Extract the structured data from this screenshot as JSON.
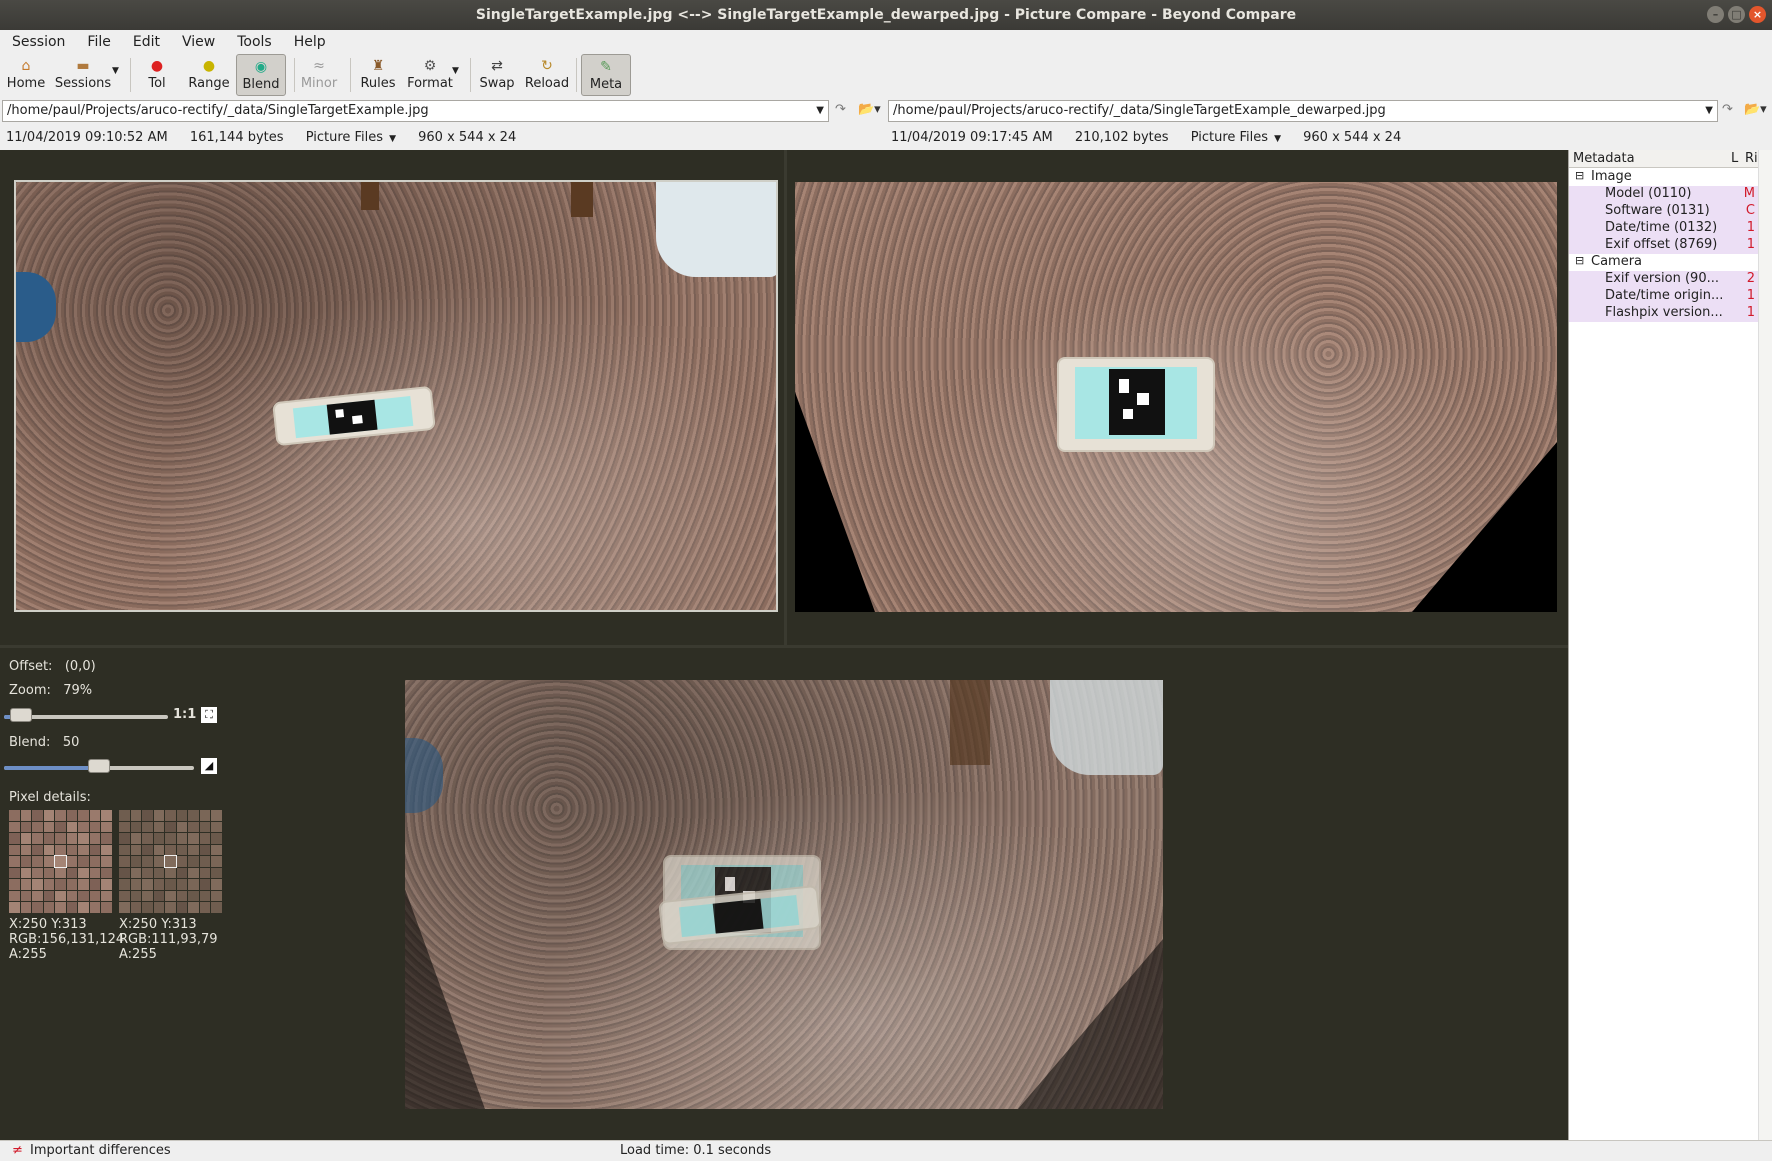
{
  "window": {
    "title": "SingleTargetExample.jpg <--> SingleTargetExample_dewarped.jpg - Picture Compare - Beyond Compare",
    "minimize": "–",
    "maximize": "□",
    "close": "×"
  },
  "menu": [
    "Session",
    "File",
    "Edit",
    "View",
    "Tools",
    "Help"
  ],
  "toolbar": {
    "home": "Home",
    "sessions": "Sessions",
    "tol": "Tol",
    "range": "Range",
    "blend": "Blend",
    "minor": "Minor",
    "rules": "Rules",
    "format": "Format",
    "swap": "Swap",
    "reload": "Reload",
    "meta": "Meta"
  },
  "left": {
    "path": "/home/paul/Projects/aruco-rectify/_data/SingleTargetExample.jpg",
    "date": "11/04/2019 09:10:52 AM",
    "size": "161,144 bytes",
    "format": "Picture Files",
    "dims": "960 x 544 x 24"
  },
  "right": {
    "path": "/home/paul/Projects/aruco-rectify/_data/SingleTargetExample_dewarped.jpg",
    "date": "11/04/2019 09:17:45 AM",
    "size": "210,102 bytes",
    "format": "Picture Files",
    "dims": "960 x 544 x 24"
  },
  "controls": {
    "offset_label": "Offset:",
    "offset_value": "(0,0)",
    "zoom_label": "Zoom:",
    "zoom_value": "79%",
    "zoom_level": 0.05,
    "one_to_one": "1:1",
    "blend_label": "Blend:",
    "blend_value": "50",
    "blend_level": 0.5,
    "pixel_details_label": "Pixel details:",
    "left_pixel": {
      "xy": "X:250 Y:313",
      "rgb": "RGB:156,131,124",
      "a": "A:255"
    },
    "right_pixel": {
      "xy": "X:250 Y:313",
      "rgb": "RGB:111,93,79",
      "a": "A:255"
    }
  },
  "metadata": {
    "headers": {
      "name": "Metadata",
      "left": "L",
      "right": "Ri"
    },
    "rows": [
      {
        "label": "Image",
        "value": "",
        "type": "group",
        "toggle": "⊟"
      },
      {
        "label": "Model (0110)",
        "value": "M",
        "type": "diff"
      },
      {
        "label": "Software (0131)",
        "value": "C",
        "type": "diff"
      },
      {
        "label": "Date/time (0132)",
        "value": "1",
        "type": "diff"
      },
      {
        "label": "Exif offset (8769)",
        "value": "1",
        "type": "diff"
      },
      {
        "label": "Camera",
        "value": "",
        "type": "group",
        "toggle": "⊟"
      },
      {
        "label": "Exif version (90...",
        "value": "2",
        "type": "diff"
      },
      {
        "label": "Date/time origin...",
        "value": "1",
        "type": "diff"
      },
      {
        "label": "Flashpix version...",
        "value": "1",
        "type": "diff"
      }
    ]
  },
  "status": {
    "important": "Important differences",
    "load_time": "Load time: 0.1 seconds"
  },
  "colors": {
    "dark_bg": "#2e2e24",
    "diff_row": "#ecdff5",
    "diff_text": "#d11a2a",
    "slider_fill": "#6d8fc6"
  }
}
